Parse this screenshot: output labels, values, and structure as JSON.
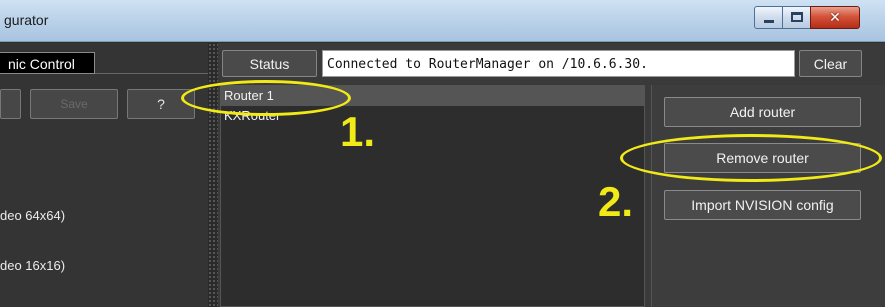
{
  "window": {
    "title": "gurator"
  },
  "left": {
    "tab_label": "nic Control",
    "buttons": {
      "left": "",
      "save": "Save",
      "help": "?"
    },
    "items": [
      "deo 64x64)",
      "deo 16x16)"
    ]
  },
  "status_bar": {
    "status_label": "Status",
    "message": "Connected to RouterManager on /10.6.6.30.",
    "clear_label": "Clear"
  },
  "routers": [
    "Router 1",
    "KXRouter"
  ],
  "actions": {
    "add": "Add router",
    "remove": "Remove router",
    "import": "Import NVISION config"
  },
  "annotations": {
    "step1": "1.",
    "step2": "2.",
    "color": "#f1ea17"
  }
}
